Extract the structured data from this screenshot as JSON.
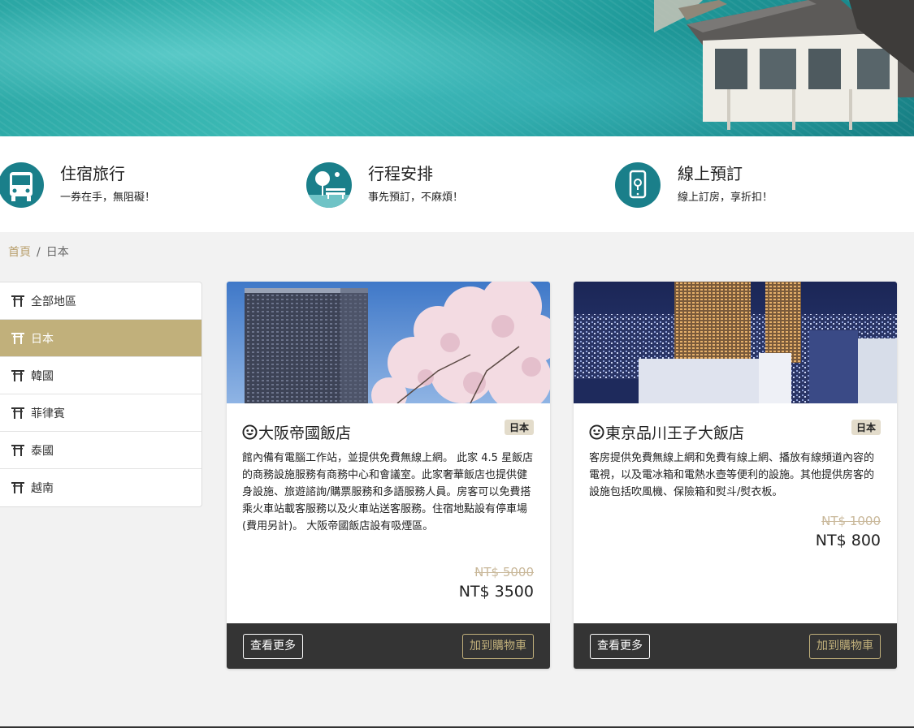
{
  "colors": {
    "accent": "#c1b07b",
    "icon_bg": "#1a7f8a",
    "footer_bg": "#343434"
  },
  "features": [
    {
      "title": "住宿旅行",
      "desc": "一券在手，無阻礙！",
      "icon": "bus-icon"
    },
    {
      "title": "行程安排",
      "desc": "事先預訂，不麻煩！",
      "icon": "park-bench-icon"
    },
    {
      "title": "線上預訂",
      "desc": "線上訂房，享折扣！",
      "icon": "mobile-pin-icon"
    }
  ],
  "breadcrumb": {
    "home": "首頁",
    "separator": "/",
    "current": "日本"
  },
  "sidebar": {
    "items": [
      {
        "label": "全部地區",
        "icon": "torii-icon"
      },
      {
        "label": "日本",
        "icon": "torii-icon",
        "active": true
      },
      {
        "label": "韓國",
        "icon": "torii-icon"
      },
      {
        "label": "菲律賓",
        "icon": "torii-icon"
      },
      {
        "label": "泰國",
        "icon": "torii-icon"
      },
      {
        "label": "越南",
        "icon": "torii-icon"
      }
    ]
  },
  "products": [
    {
      "title": "大阪帝國飯店",
      "badge": "日本",
      "desc": "館內備有電腦工作站，並提供免費無線上網。 此家 4.5 星飯店的商務設施服務有商務中心和會議室。此家奢華飯店也提供健身設施、旅遊諮詢/購票服務和多語服務人員。房客可以免費搭乘火車站載客服務以及火車站送客服務。住宿地點設有停車場 (費用另計)。 大阪帝國飯店設有吸煙區。",
      "original_price": "NT$ 5000",
      "price": "NT$ 3500",
      "more_label": "查看更多",
      "cart_label": "加到購物車"
    },
    {
      "title": "東京品川王子大飯店",
      "badge": "日本",
      "desc": "客房提供免費無線上網和免費有線上網、播放有線頻道內容的電視，以及電冰箱和電熱水壺等便利的設施。其他提供房客的設施包括吹風機、保險箱和熨斗/熨衣板。",
      "original_price": "NT$ 1000",
      "price": "NT$ 800",
      "more_label": "查看更多",
      "cart_label": "加到購物車"
    }
  ]
}
